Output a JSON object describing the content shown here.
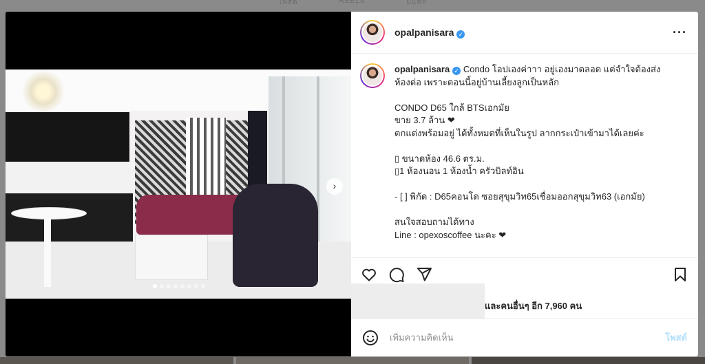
{
  "background_tabs": [
    "โพสต์",
    "REELS",
    "มีแท็ก"
  ],
  "post": {
    "username": "opalpanisara",
    "more_icon": "more-horizontal-icon",
    "caption_lines": [
      "Condo โอปเองค่าาา อยู่เองมาตลอด แต่จำใจต้องส่ง",
      "ห้องต่อ เพราะตอนนี้อยู่บ้านเลี้ยงลูกเป็นหลัก",
      "",
      "CONDO D65 ใกล้ BTSเอกมัย",
      "ขาย 3.7 ล้าน ❤",
      "ตกแต่งพร้อมอยู่ ได้ทั้งหมดที่เห็นในรูป ลากกระเป๋าเข้ามาได้เลยค่ะ",
      "",
      "ขนาดห้อง 46.6 ตร.ม.",
      "1 ห้องนอน 1 ห้องน้ำ ครัวบิลท์อิน",
      "",
      "- [ ] พิกัด : D65คอนโด ซอยสุขุมวิท65เชื่อมออกสุขุมวิท63 (เอกมัย)",
      "",
      "สนใจสอบถามได้ทาง",
      "Line : opexoscoffee นะคะ ❤"
    ],
    "carousel": {
      "total_slides": 8,
      "active_slide": 1
    },
    "likes_text": "และคนอื่นๆ อีก 7,960 คน",
    "comment_placeholder": "เพิ่มความคิดเห็น",
    "post_label": "โพสต์"
  },
  "icons": {
    "like": "heart-icon",
    "comment": "comment-icon",
    "share": "send-icon",
    "save": "bookmark-icon",
    "emoji": "emoji-icon",
    "next": "chevron-right-icon"
  },
  "colors": {
    "verified": "#3897f0",
    "post_button": "#b2dffc",
    "backdrop": "#8a8a8a"
  }
}
